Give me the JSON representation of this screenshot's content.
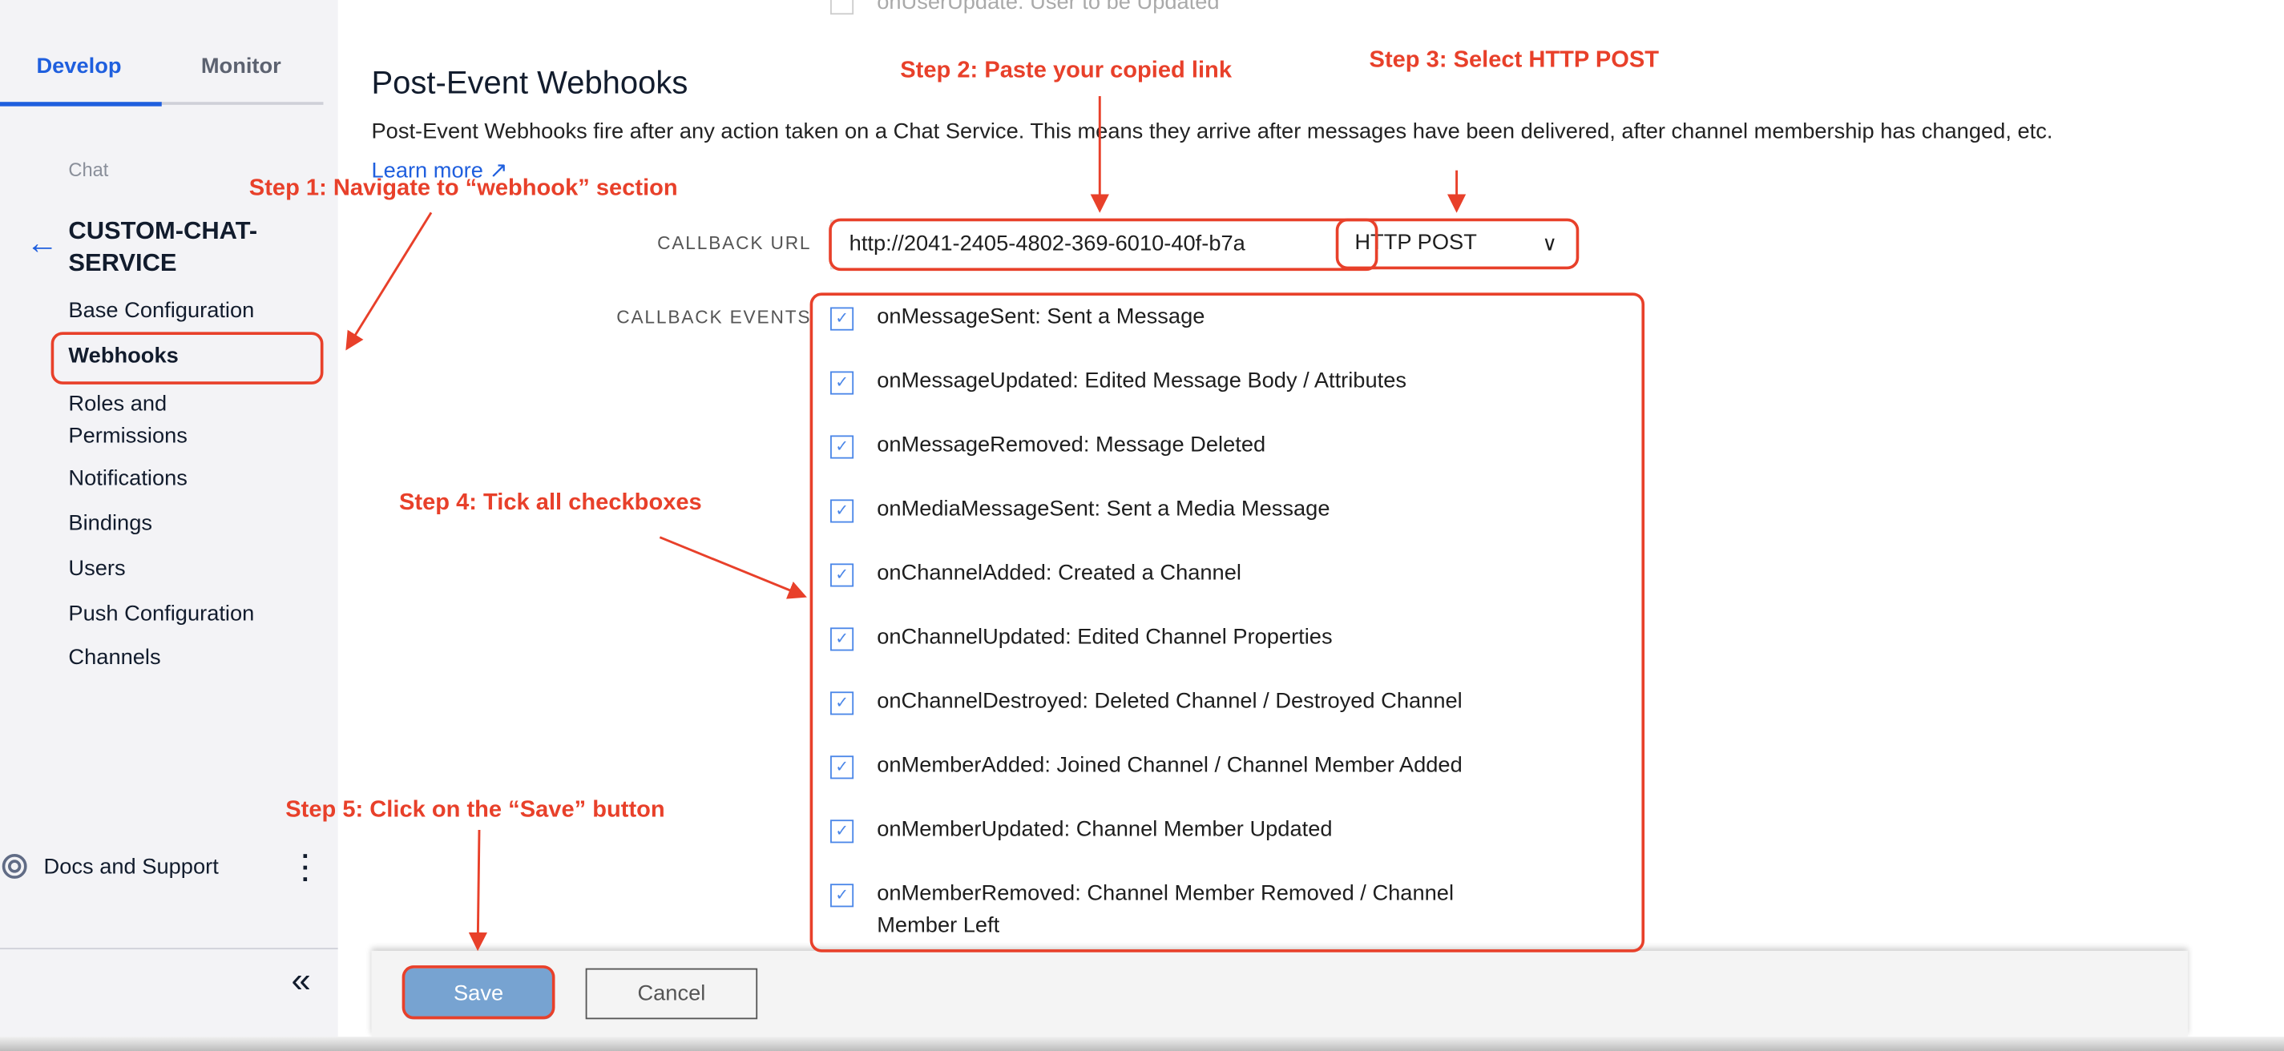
{
  "sidebar": {
    "tabs": [
      {
        "label": "Develop",
        "active": true
      },
      {
        "label": "Monitor",
        "active": false
      }
    ],
    "section": "Chat",
    "service_name_line1": "CUSTOM-CHAT-",
    "service_name_line2": "SERVICE",
    "items": [
      "Base Configuration",
      "Webhooks",
      "Roles and",
      "Permissions",
      "Notifications",
      "Bindings",
      "Users",
      "Push Configuration",
      "Channels"
    ],
    "active_item": "Webhooks",
    "docs": "Docs and Support",
    "collapse": "«"
  },
  "main": {
    "prev_event": "onUserUpdate: User to be Updated",
    "title": "Post-Event Webhooks",
    "description": "Post-Event Webhooks fire after any action taken on a Chat Service. This means they arrive after messages have been delivered, after channel membership has changed, etc.",
    "learn_more": "Learn more ↗",
    "callback_url_label": "CALLBACK URL",
    "callback_url_value": "http://2041-2405-4802-369-6010-40f-b7a",
    "method": "HTTP POST",
    "callback_events_label": "CALLBACK EVENTS",
    "events": [
      {
        "label": "onMessageSent: Sent a Message",
        "checked": true
      },
      {
        "label": "onMessageUpdated: Edited Message Body / Attributes",
        "checked": true
      },
      {
        "label": "onMessageRemoved: Message Deleted",
        "checked": true
      },
      {
        "label": "onMediaMessageSent: Sent a Media Message",
        "checked": true
      },
      {
        "label": "onChannelAdded: Created a Channel",
        "checked": true
      },
      {
        "label": "onChannelUpdated: Edited Channel Properties",
        "checked": true
      },
      {
        "label": "onChannelDestroyed: Deleted Channel / Destroyed Channel",
        "checked": true
      },
      {
        "label": "onMemberAdded: Joined Channel / Channel Member Added",
        "checked": true
      },
      {
        "label": "onMemberUpdated: Channel Member Updated",
        "checked": true
      },
      {
        "label": "onMemberRemoved: Channel Member Removed / Channel",
        "checked": true
      }
    ],
    "last_event_line2": "Member Left",
    "save": "Save",
    "cancel": "Cancel"
  },
  "annotations": {
    "step1": "Step 1: Navigate to “webhook” section",
    "step2": "Step 2: Paste your copied link",
    "step3": "Step 3: Select HTTP POST",
    "step4": "Step 4: Tick all checkboxes",
    "step5": "Step 5: Click on the “Save” button"
  },
  "colors": {
    "accent": "#1f5fde",
    "annotation": "#e8402a",
    "save_button": "#77a3d1"
  }
}
